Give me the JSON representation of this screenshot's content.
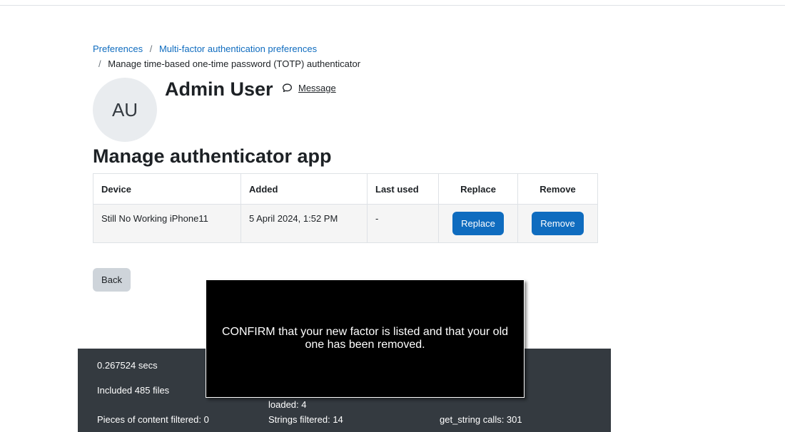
{
  "breadcrumb": {
    "items": [
      {
        "label": "Preferences"
      },
      {
        "label": "Multi-factor authentication preferences"
      },
      {
        "label": "Manage time-based one-time password (TOTP) authenticator"
      }
    ],
    "separator": "/"
  },
  "user": {
    "initials": "AU",
    "name": "Admin User",
    "message_label": "Message",
    "message_icon": "chat-bubble-icon"
  },
  "page": {
    "heading": "Manage authenticator app"
  },
  "table": {
    "headers": {
      "device": "Device",
      "added": "Added",
      "last_used": "Last used",
      "replace": "Replace",
      "remove": "Remove"
    },
    "rows": [
      {
        "device": "Still No Working iPhone11",
        "added": "5 April 2024, 1:52 PM",
        "last_used": "-",
        "replace_button": "Replace",
        "remove_button": "Remove"
      }
    ]
  },
  "actions": {
    "back_label": "Back"
  },
  "footer": {
    "time": "0.267524 secs",
    "included_files": "Included 485 files",
    "loaded": "loaded: 4",
    "content_filtered": "Pieces of content filtered: 0",
    "strings_filtered": "Strings filtered: 14",
    "get_string_calls": "get_string calls: 301"
  },
  "overlay": {
    "message": "CONFIRM that your new factor is listed and that your old one has been removed."
  },
  "colors": {
    "link": "#0f6cbf",
    "primary_button": "#0f6cbf",
    "secondary_button": "#ced4da",
    "footer_bg": "#343a40",
    "overlay_bg": "#000000"
  }
}
